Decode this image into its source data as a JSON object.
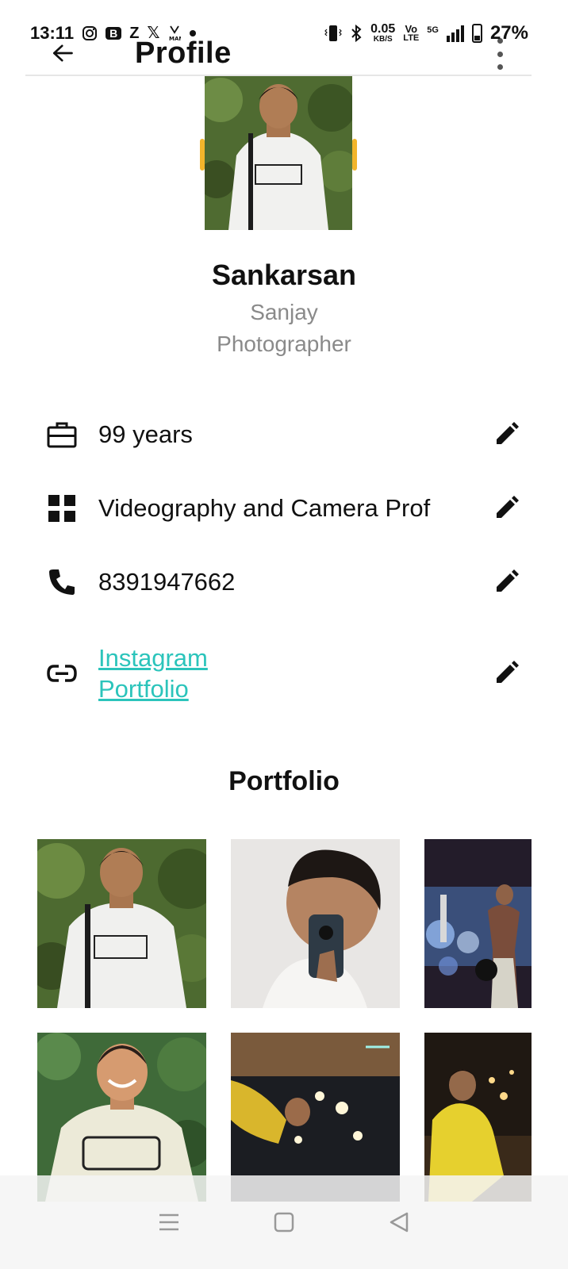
{
  "status_bar": {
    "time": "13:11",
    "network_speed": "0.05",
    "network_unit": "KB/S",
    "volte_top": "Vo",
    "volte_bottom": "LTE",
    "network_type": "5G",
    "battery": "27%",
    "notification_icons": [
      "instagram-icon",
      "b-app-icon",
      "z-icon",
      "x-icon",
      "man-icon",
      "dot-icon"
    ],
    "b_label": "B",
    "z_label": "Z",
    "x_label": "𝕏"
  },
  "appbar": {
    "title": "Profile"
  },
  "profile": {
    "name": "Sankarsan",
    "subname": "Sanjay",
    "role": "Photographer"
  },
  "info": {
    "experience": "99 years",
    "specialty": "Videography and Camera Prof",
    "phone": "8391947662",
    "link_line1": "Instagram",
    "link_line2": "Portfolio"
  },
  "portfolio": {
    "title": "Portfolio"
  },
  "colors": {
    "accent_link": "#2bc4bb",
    "secondary_text": "#8a8a8a",
    "avatar_ring": "#f2b52b"
  }
}
